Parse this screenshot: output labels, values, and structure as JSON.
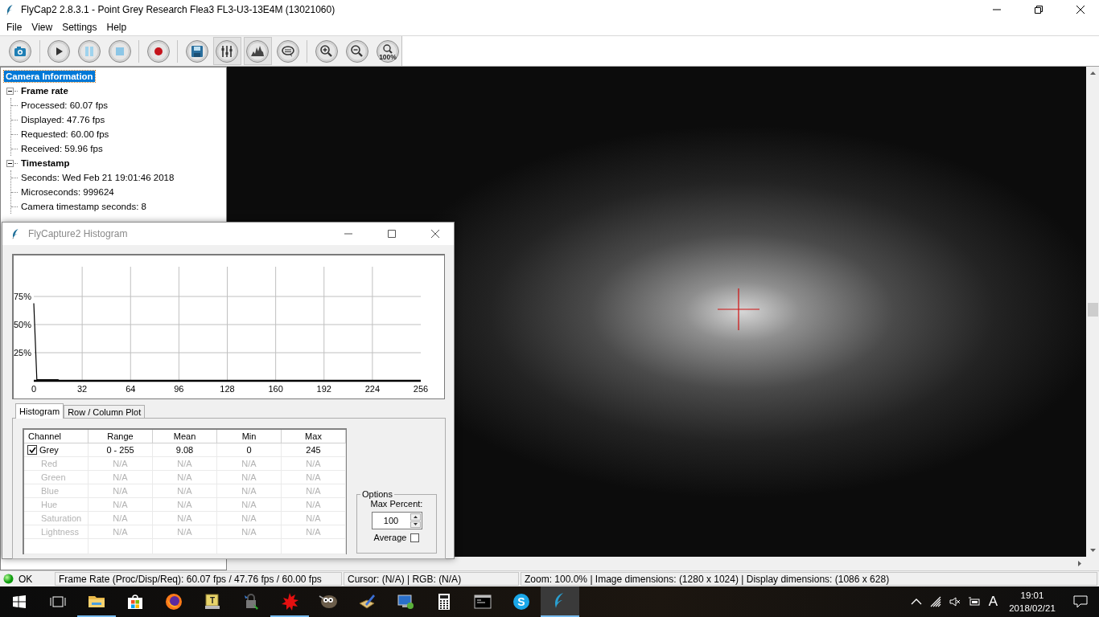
{
  "window": {
    "title": "FlyCap2 2.8.3.1 - Point Grey Research Flea3 FL3-U3-13E4M (13021060)"
  },
  "menu": [
    "File",
    "View",
    "Settings",
    "Help"
  ],
  "toolbar": [
    {
      "kind": "camera",
      "pressed": false
    },
    {
      "kind": "play",
      "pressed": false
    },
    {
      "kind": "pause",
      "pressed": false
    },
    {
      "kind": "stop",
      "pressed": false
    },
    {
      "kind": "record",
      "pressed": false
    },
    {
      "kind": "save",
      "pressed": false
    },
    {
      "kind": "settings",
      "pressed": true
    },
    {
      "kind": "histogram",
      "pressed": true
    },
    {
      "kind": "message",
      "pressed": false
    },
    {
      "kind": "zoom-in",
      "pressed": false
    },
    {
      "kind": "zoom-out",
      "pressed": false
    },
    {
      "kind": "zoom-100",
      "pressed": false,
      "label": "100%"
    }
  ],
  "tree": [
    {
      "label": "Camera Information",
      "selected": true,
      "children": [
        {
          "label": "Frame rate",
          "selected": false,
          "expanded": true,
          "children": [
            {
              "label": "Processed: 60.07 fps",
              "selected": false
            },
            {
              "label": "Displayed: 47.76 fps",
              "selected": false
            },
            {
              "label": "Requested: 60.00 fps",
              "selected": false
            },
            {
              "label": "Received: 59.96 fps",
              "selected": false
            }
          ]
        },
        {
          "label": "Timestamp",
          "selected": false,
          "expanded": true,
          "children": [
            {
              "label": "Seconds: Wed Feb 21 19:01:46 2018",
              "selected": false
            },
            {
              "label": "Microseconds: 999624",
              "selected": false
            },
            {
              "label": "Camera timestamp seconds: 8",
              "selected": false
            }
          ]
        }
      ]
    }
  ],
  "status_bar": {
    "status": "OK",
    "sections": [
      "Frame Rate (Proc/Disp/Req): 60.07 fps / 47.76 fps / 60.00 fps",
      "Cursor: (N/A) | RGB: (N/A)",
      "Zoom: 100.0% | Image dimensions: (1280 x 1024) | Display dimensions: (1086 x 628)"
    ]
  },
  "histogram_dialog": {
    "title": "FlyCapture2 Histogram",
    "chart_data": {
      "type": "line",
      "x": [
        0,
        1,
        2,
        16,
        17,
        256
      ],
      "xlim": [
        0,
        256
      ],
      "ylim": [
        0,
        100
      ],
      "xticks": [
        0,
        32,
        64,
        96,
        128,
        160,
        192,
        224,
        256
      ],
      "yticks": [
        {
          "value": 25,
          "label": "25%"
        },
        {
          "value": 50,
          "label": "50%"
        },
        {
          "value": 75,
          "label": "75%"
        }
      ],
      "grid": true,
      "series": [
        {
          "color": "#000000",
          "values": [
            69,
            35,
            1,
            1,
            0,
            0
          ]
        }
      ]
    },
    "tabs": [
      {
        "label": "Histogram",
        "selected": true
      },
      {
        "label": "Row / Column Plot",
        "selected": false
      }
    ],
    "table": {
      "columns": [
        "Channel",
        "Range",
        "Mean",
        "Min",
        "Max"
      ],
      "rows": [
        {
          "kind": "checkbox",
          "checked": true,
          "disabled": false,
          "cells": [
            "Grey",
            "0 - 255",
            "9.08",
            "0",
            "245"
          ]
        },
        {
          "kind": "plain",
          "disabled": true,
          "cells": [
            "Red",
            "N/A",
            "N/A",
            "N/A",
            "N/A"
          ]
        },
        {
          "kind": "plain",
          "disabled": true,
          "cells": [
            "Green",
            "N/A",
            "N/A",
            "N/A",
            "N/A"
          ]
        },
        {
          "kind": "plain",
          "disabled": true,
          "cells": [
            "Blue",
            "N/A",
            "N/A",
            "N/A",
            "N/A"
          ]
        },
        {
          "kind": "plain",
          "disabled": true,
          "cells": [
            "Hue",
            "N/A",
            "N/A",
            "N/A",
            "N/A"
          ]
        },
        {
          "kind": "plain",
          "disabled": true,
          "cells": [
            "Saturation",
            "N/A",
            "N/A",
            "N/A",
            "N/A"
          ]
        },
        {
          "kind": "plain",
          "disabled": true,
          "cells": [
            "Lightness",
            "N/A",
            "N/A",
            "N/A",
            "N/A"
          ]
        }
      ]
    },
    "options": {
      "title": "Options",
      "max_percent_label": "Max Percent:",
      "max_percent": "100",
      "average_label": "Average",
      "average": false
    }
  },
  "taskbar": {
    "apps": [
      {
        "kind": "folder",
        "open": true,
        "active": false
      },
      {
        "kind": "store",
        "open": false,
        "active": false
      },
      {
        "kind": "browser",
        "open": false,
        "active": false
      },
      {
        "kind": "notes",
        "open": false,
        "active": false,
        "label": "T"
      },
      {
        "kind": "lock",
        "open": false,
        "active": false
      },
      {
        "kind": "splat",
        "open": true,
        "active": false
      },
      {
        "kind": "mascot",
        "open": false,
        "active": false
      },
      {
        "kind": "pen",
        "open": false,
        "active": false
      },
      {
        "kind": "monitor",
        "open": false,
        "active": false
      },
      {
        "kind": "calculator",
        "open": false,
        "active": false
      },
      {
        "kind": "terminal",
        "open": false,
        "active": false
      },
      {
        "kind": "chat",
        "open": false,
        "active": false,
        "label": "S"
      },
      {
        "kind": "feather",
        "open": true,
        "active": true
      }
    ],
    "tray": {
      "ime": "A",
      "time": "19:01",
      "date": "2018/02/21"
    }
  }
}
